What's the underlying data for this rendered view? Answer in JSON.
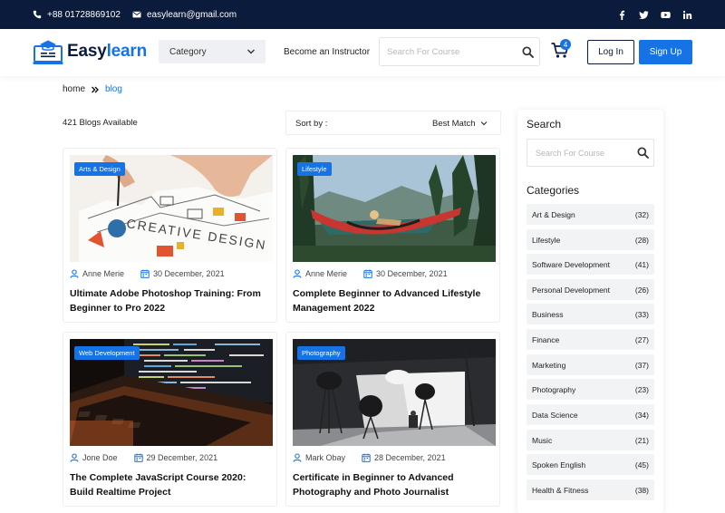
{
  "topbar": {
    "phone": "+88 01728869102",
    "email": "easylearn@gmail.com"
  },
  "header": {
    "logo": {
      "part1": "Easy",
      "part2": "learn"
    },
    "category_label": "Category",
    "instructor_label": "Become an Instructor",
    "search_placeholder": "Search For Course",
    "cart_count": "4",
    "login_label": "Log In",
    "signup_label": "Sign Up"
  },
  "breadcrumb": {
    "home": "home",
    "current": "blog"
  },
  "results": {
    "count": "421 Blogs Available",
    "sort_label": "Sort by :",
    "sort_value": "Best Match"
  },
  "cards": [
    {
      "tag": "Arts & Design",
      "author": "Anne Merie",
      "date": "30 December, 2021",
      "title": "Ultimate Adobe Photoshop Training: From Beginner to Pro 2022"
    },
    {
      "tag": "Lifestyle",
      "author": "Anne Merie",
      "date": "30 December, 2021",
      "title": "Complete Beginner to Advanced Lifestyle Management 2022"
    },
    {
      "tag": "Web Development",
      "author": "Jone Doe",
      "date": "29 December, 2021",
      "title": "The Complete JavaScript Course 2020: Build Realtime Project"
    },
    {
      "tag": "Photography",
      "author": "Mark Obay",
      "date": "28 December, 2021",
      "title": "Certificate in Beginner to Advanced Photography and Photo Journalist"
    }
  ],
  "sidebar": {
    "search_heading": "Search",
    "search_placeholder": "Search For Course",
    "categories_heading": "Categories",
    "categories": [
      {
        "name": "Art & Design",
        "count": "(32)"
      },
      {
        "name": "Lifestyle",
        "count": "(28)"
      },
      {
        "name": "Software Development",
        "count": "(41)"
      },
      {
        "name": "Personal Development",
        "count": "(26)"
      },
      {
        "name": "Business",
        "count": "(33)"
      },
      {
        "name": "Finance",
        "count": "(27)"
      },
      {
        "name": "Marketing",
        "count": "(37)"
      },
      {
        "name": "Photography",
        "count": "(23)"
      },
      {
        "name": "Data Science",
        "count": "(34)"
      },
      {
        "name": "Music",
        "count": "(21)"
      },
      {
        "name": "Spoken English",
        "count": "(45)"
      },
      {
        "name": "Health & Fitness",
        "count": "(38)"
      }
    ]
  },
  "colors": {
    "navy": "#0b1b3b",
    "accent": "#1673e6"
  }
}
